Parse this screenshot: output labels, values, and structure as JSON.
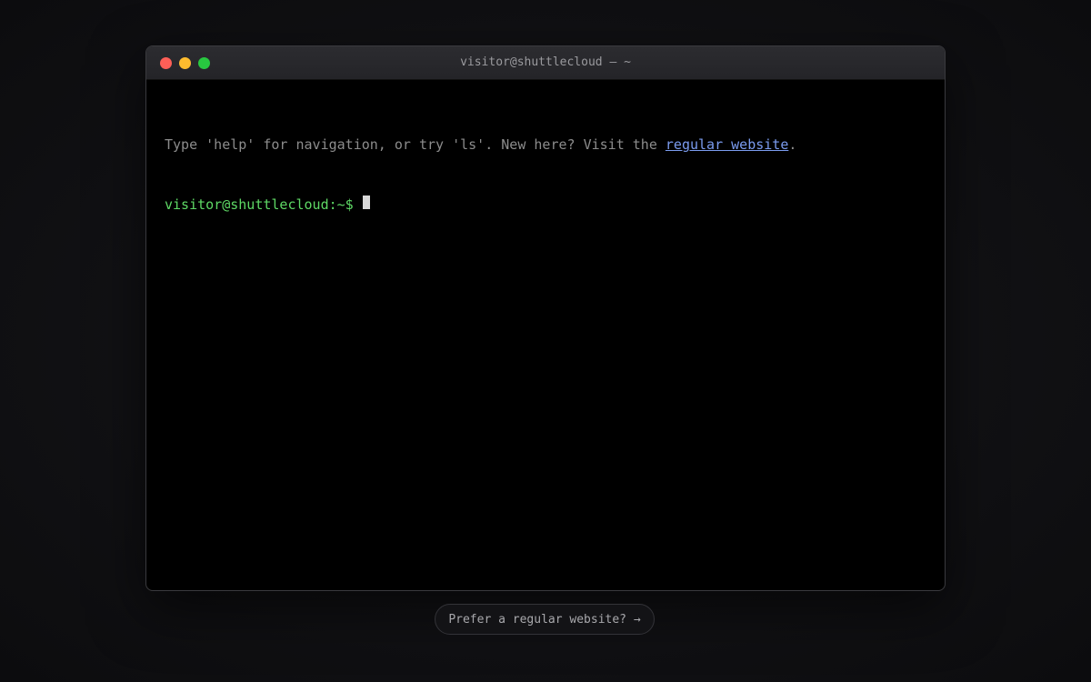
{
  "window": {
    "title": "visitor@shuttlecloud — ~"
  },
  "terminal": {
    "help_text_before": "Type 'help' for navigation, or try 'ls'. New here? Visit the ",
    "help_link_text": "regular website",
    "help_text_after": ".",
    "prompt": "visitor@shuttlecloud:~$",
    "input_value": ""
  },
  "footer": {
    "alt_button_label": "Prefer a regular website? →"
  },
  "colors": {
    "prompt": "#5ed865",
    "link": "#7b9cf0",
    "close": "#ff5f57",
    "minimize": "#febc2e",
    "zoom": "#28c840"
  }
}
